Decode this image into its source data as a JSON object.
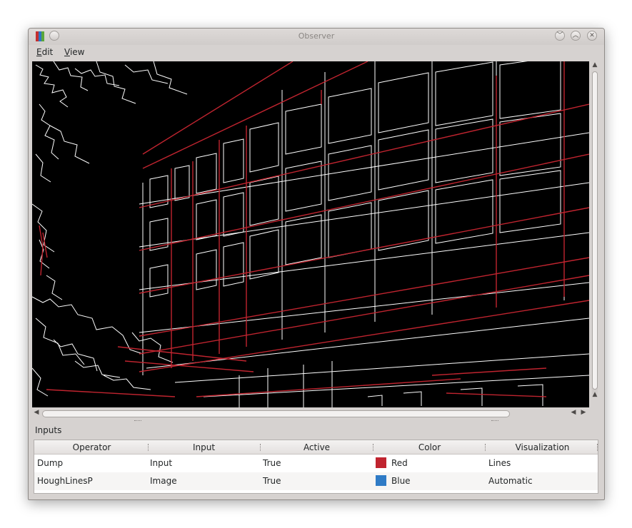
{
  "window": {
    "title": "Observer",
    "menu": [
      {
        "label": "Edit",
        "mnemonic": "E",
        "rest": "dit"
      },
      {
        "label": "View",
        "mnemonic": "V",
        "rest": "iew"
      }
    ]
  },
  "viewer": {
    "description_icon": "edge-image-canvas"
  },
  "panel": {
    "title": "Inputs",
    "columns": [
      "Operator",
      "Input",
      "Active",
      "Color",
      "Visualization"
    ],
    "rows": [
      {
        "operator": "Dump",
        "input": "Input",
        "active": "True",
        "color": "Red",
        "color_hex": "#c0242f",
        "visualization": "Lines"
      },
      {
        "operator": "HoughLinesP",
        "input": "Image",
        "active": "True",
        "color": "Blue",
        "color_hex": "#2f7bc6",
        "visualization": "Automatic"
      }
    ]
  }
}
